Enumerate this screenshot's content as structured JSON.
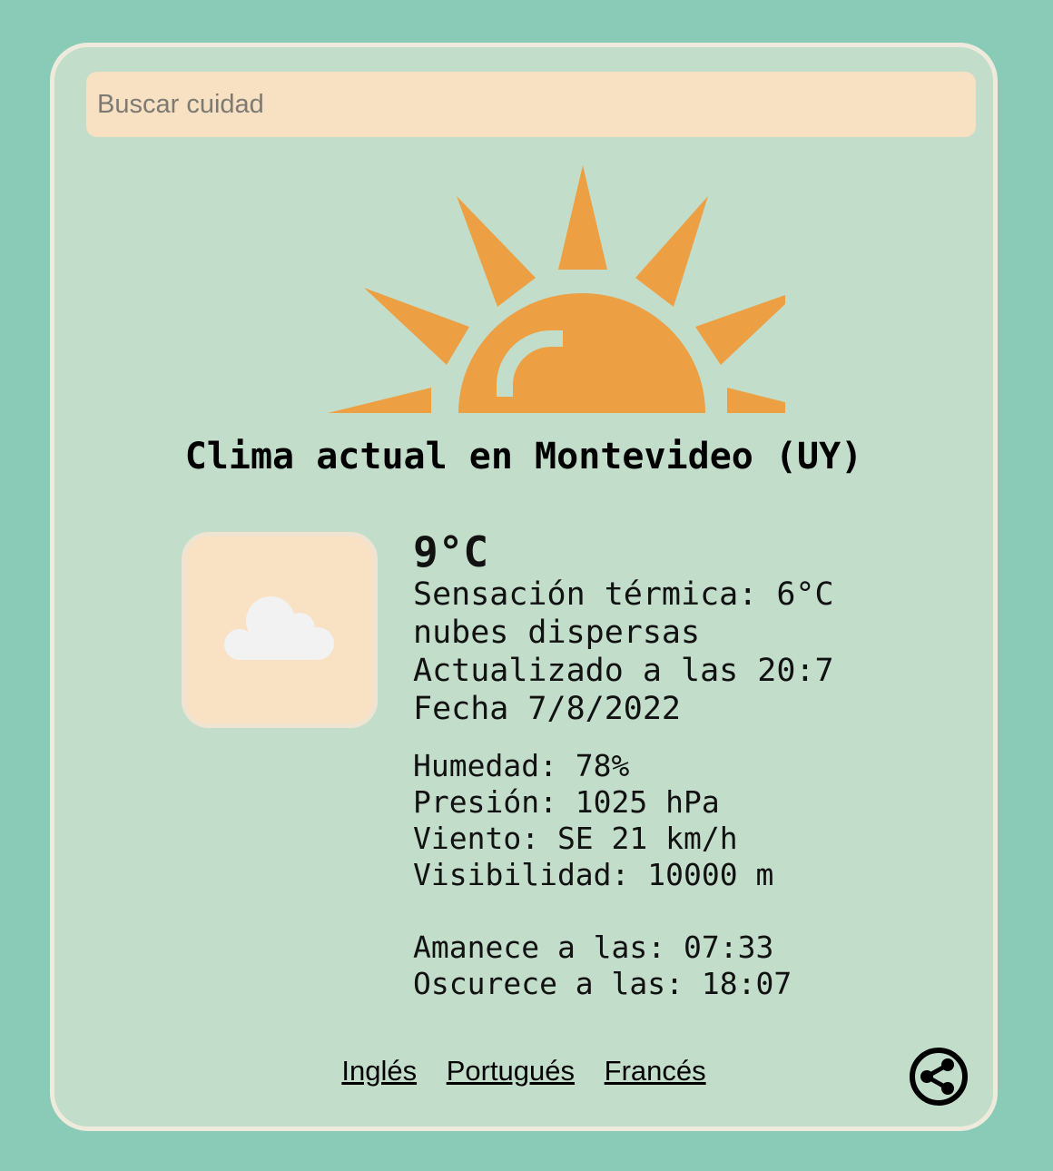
{
  "search": {
    "placeholder": "Buscar cuidad",
    "value": ""
  },
  "title": "Clima actual en Montevideo (UY)",
  "weather": {
    "icon": "cloud-icon",
    "temperature": "9°C",
    "feels_like": "Sensación térmica: 6°C",
    "description": "nubes dispersas",
    "updated": "Actualizado a las 20:7",
    "date": "Fecha 7/8/2022"
  },
  "details": {
    "humidity": "Humedad: 78%",
    "pressure": "Presión: 1025 hPa",
    "wind": "Viento: SE 21 km/h",
    "visibility": "Visibilidad: 10000 m"
  },
  "sun_times": {
    "sunrise": "Amanece a las: 07:33",
    "sunset": "Oscurece a las: 18:07"
  },
  "languages": [
    "Inglés",
    "Portugués",
    "Francés"
  ],
  "share_icon": "share-icon",
  "colors": {
    "background": "#8acbb8",
    "card": "#c3ddcb",
    "card_border": "#eeebdd",
    "search_bg": "#f7e1c2",
    "sun": "#eca043",
    "cloud": "#f2f2f2"
  }
}
